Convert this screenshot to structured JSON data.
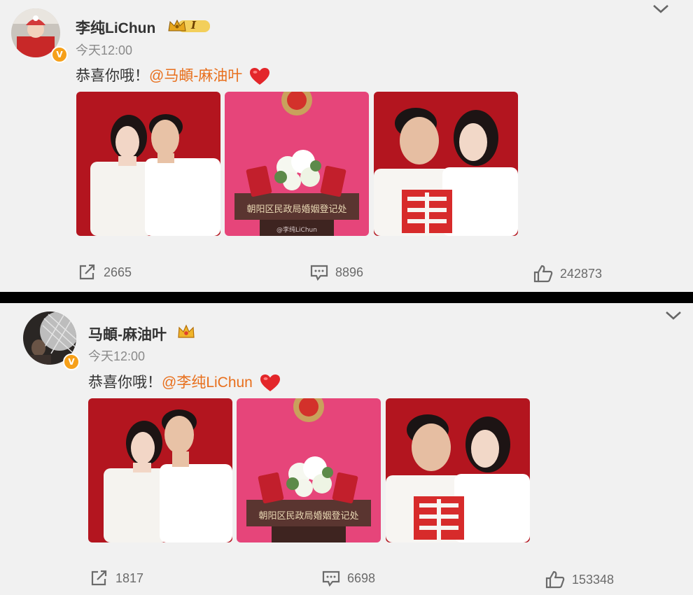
{
  "posts": [
    {
      "author": "李纯LiChun",
      "time": "今天12:00",
      "text": "恭喜你哦！",
      "mention": "@马頔-麻油叶",
      "verified_badge": "V",
      "rank_badge": "I",
      "photo_caption": "朝阳区民政局婚姻登记处",
      "watermark": "@李纯LiChun",
      "actions": {
        "share": "2665",
        "comment": "8896",
        "like": "242873"
      }
    },
    {
      "author": "马頔-麻油叶",
      "time": "今天12:00",
      "text": "恭喜你哦！",
      "mention": "@李纯LiChun",
      "verified_badge": "V",
      "photo_caption": "朝阳区民政局婚姻登记处",
      "actions": {
        "share": "1817",
        "comment": "6698",
        "like": "153348"
      }
    }
  ],
  "icons": [
    "chevron-down-icon",
    "share-icon",
    "comment-icon",
    "like-icon",
    "heart-icon",
    "crown-icon"
  ],
  "colors": {
    "mention": "#e86f1c",
    "badge": "#f6a01a",
    "photo_red": "#b3151f",
    "photo_pink": "#e6457a"
  }
}
